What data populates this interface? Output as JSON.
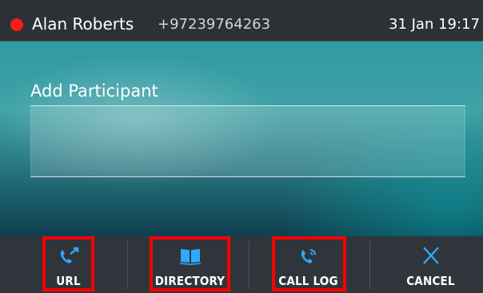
{
  "status_bar": {
    "caller_name": "Alan Roberts",
    "caller_number": "+97239764263",
    "datetime": "31 Jan 19:17",
    "record_indicator_color": "#ff1a1a"
  },
  "main": {
    "title": "Add Participant",
    "participant_input_value": ""
  },
  "softkeys": [
    {
      "label": "URL",
      "icon": "phone-transfer-icon",
      "highlighted": true
    },
    {
      "label": "DIRECTORY",
      "icon": "book-icon",
      "highlighted": true
    },
    {
      "label": "CALL LOG",
      "icon": "call-log-icon",
      "highlighted": true
    },
    {
      "label": "CANCEL",
      "icon": "close-icon",
      "highlighted": false
    }
  ],
  "colors": {
    "icon_blue": "#2fa8ff",
    "highlight_red": "#ff0000"
  }
}
